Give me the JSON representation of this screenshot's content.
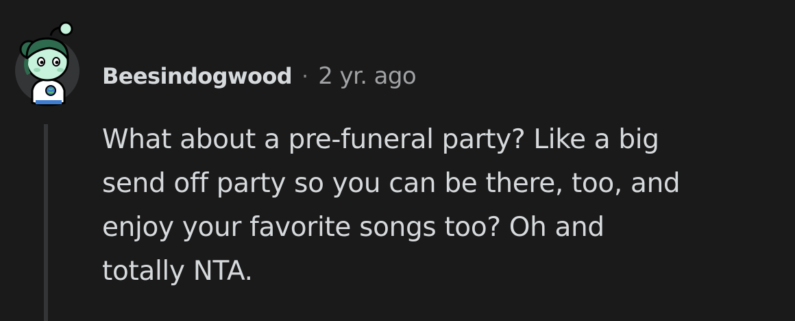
{
  "comment": {
    "author": "Beesindogwood",
    "separator": "·",
    "timestamp": "2 yr. ago",
    "body_lines": [
      "What about a pre-funeral party? Like a big",
      "send off party so you can be there, too, and",
      "enjoy your favorite songs too? Oh and",
      "totally NTA."
    ]
  },
  "avatar": {
    "icon": "snoo-avatar-icon",
    "background": "#343536",
    "hair": "#2e6b4e",
    "skin": "#c7f2dc",
    "shirt": "#ffffff",
    "globe": "#3d7ccf"
  },
  "colors": {
    "background": "#1a1a1b",
    "text": "#d7dadc",
    "meta": "#a1a3a5",
    "thread_line": "#343536"
  }
}
